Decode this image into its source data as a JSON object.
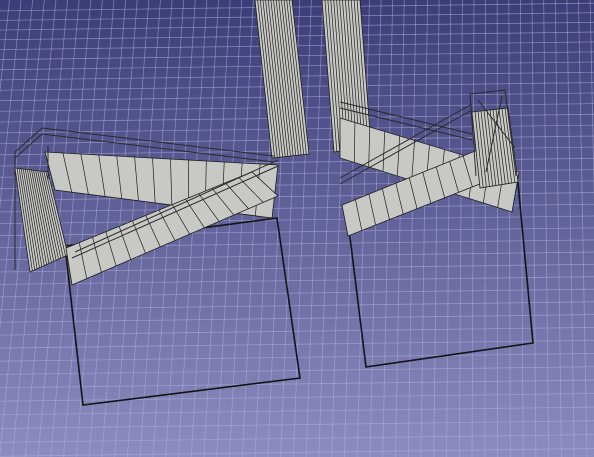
{
  "viewport": {
    "type": "3d-cad-viewport",
    "colors": {
      "background_top": "#3c3c78",
      "background_bottom": "#8c8cc0",
      "grid_line": "#b4b4dc",
      "stair_face": "#c8c8c4",
      "stair_edge": "#1e1e1e",
      "outline": "#141414"
    },
    "objects": [
      {
        "name": "stair-assembly-left"
      },
      {
        "name": "stair-assembly-right"
      },
      {
        "name": "footprint-left"
      },
      {
        "name": "footprint-right"
      }
    ]
  }
}
